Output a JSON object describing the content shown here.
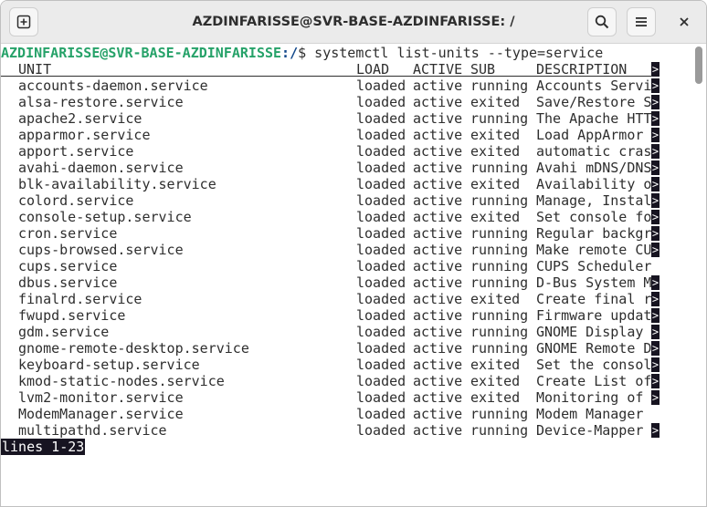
{
  "window": {
    "title": "AZDINFARISSE@SVR-BASE-AZDINFARISSE: /",
    "buttons": {
      "new_tab_icon": "new-tab-icon",
      "search_icon": "search-icon",
      "menu_icon": "hamburger-menu-icon",
      "close_icon": "close-icon"
    }
  },
  "terminal": {
    "prompt_user": "AZDINFARISSE@SVR-BASE-AZDINFARISSE",
    "prompt_path": ":/",
    "prompt_symbol": "$ ",
    "command": "systemctl list-units --type=service",
    "headers": {
      "unit": "UNIT",
      "load": "LOAD",
      "active": "ACTIVE",
      "sub": "SUB",
      "description": "DESCRIPTION"
    },
    "more_marker": ">",
    "rows": [
      {
        "unit": "accounts-daemon.service",
        "load": "loaded",
        "active": "active",
        "sub": "running",
        "description": "Accounts Servi",
        "truncated": true
      },
      {
        "unit": "alsa-restore.service",
        "load": "loaded",
        "active": "active",
        "sub": "exited",
        "description": "Save/Restore S",
        "truncated": true
      },
      {
        "unit": "apache2.service",
        "load": "loaded",
        "active": "active",
        "sub": "running",
        "description": "The Apache HTT",
        "truncated": true
      },
      {
        "unit": "apparmor.service",
        "load": "loaded",
        "active": "active",
        "sub": "exited",
        "description": "Load AppArmor ",
        "truncated": true
      },
      {
        "unit": "apport.service",
        "load": "loaded",
        "active": "active",
        "sub": "exited",
        "description": "automatic cras",
        "truncated": true
      },
      {
        "unit": "avahi-daemon.service",
        "load": "loaded",
        "active": "active",
        "sub": "running",
        "description": "Avahi mDNS/DNS",
        "truncated": true
      },
      {
        "unit": "blk-availability.service",
        "load": "loaded",
        "active": "active",
        "sub": "exited",
        "description": "Availability o",
        "truncated": true
      },
      {
        "unit": "colord.service",
        "load": "loaded",
        "active": "active",
        "sub": "running",
        "description": "Manage, Instal",
        "truncated": true
      },
      {
        "unit": "console-setup.service",
        "load": "loaded",
        "active": "active",
        "sub": "exited",
        "description": "Set console fo",
        "truncated": true
      },
      {
        "unit": "cron.service",
        "load": "loaded",
        "active": "active",
        "sub": "running",
        "description": "Regular backgr",
        "truncated": true
      },
      {
        "unit": "cups-browsed.service",
        "load": "loaded",
        "active": "active",
        "sub": "running",
        "description": "Make remote CU",
        "truncated": true
      },
      {
        "unit": "cups.service",
        "load": "loaded",
        "active": "active",
        "sub": "running",
        "description": "CUPS Scheduler",
        "truncated": false
      },
      {
        "unit": "dbus.service",
        "load": "loaded",
        "active": "active",
        "sub": "running",
        "description": "D-Bus System M",
        "truncated": true
      },
      {
        "unit": "finalrd.service",
        "load": "loaded",
        "active": "active",
        "sub": "exited",
        "description": "Create final r",
        "truncated": true
      },
      {
        "unit": "fwupd.service",
        "load": "loaded",
        "active": "active",
        "sub": "running",
        "description": "Firmware updat",
        "truncated": true
      },
      {
        "unit": "gdm.service",
        "load": "loaded",
        "active": "active",
        "sub": "running",
        "description": "GNOME Display ",
        "truncated": true
      },
      {
        "unit": "gnome-remote-desktop.service",
        "load": "loaded",
        "active": "active",
        "sub": "running",
        "description": "GNOME Remote D",
        "truncated": true
      },
      {
        "unit": "keyboard-setup.service",
        "load": "loaded",
        "active": "active",
        "sub": "exited",
        "description": "Set the consol",
        "truncated": true
      },
      {
        "unit": "kmod-static-nodes.service",
        "load": "loaded",
        "active": "active",
        "sub": "exited",
        "description": "Create List of",
        "truncated": true
      },
      {
        "unit": "lvm2-monitor.service",
        "load": "loaded",
        "active": "active",
        "sub": "exited",
        "description": "Monitoring of ",
        "truncated": true
      },
      {
        "unit": "ModemManager.service",
        "load": "loaded",
        "active": "active",
        "sub": "running",
        "description": "Modem Manager",
        "truncated": false
      },
      {
        "unit": "multipathd.service",
        "load": "loaded",
        "active": "active",
        "sub": "running",
        "description": "Device-Mapper ",
        "truncated": true
      }
    ],
    "status_line": "lines 1-23"
  }
}
